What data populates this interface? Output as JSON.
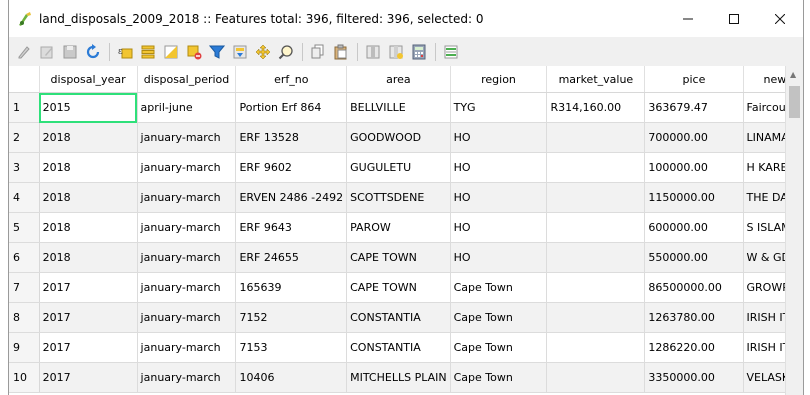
{
  "window": {
    "title": "land_disposals_2009_2018 :: Features total: 396, filtered: 396, selected: 0"
  },
  "toolbar": {
    "buttons": [
      {
        "name": "toggle-editing-button",
        "icon": "pencil-icon"
      },
      {
        "name": "toggle-multi-edit-button",
        "icon": "multi-edit-icon"
      },
      {
        "name": "save-edits-button",
        "icon": "save-icon"
      },
      {
        "name": "reload-table-button",
        "icon": "reload-icon"
      },
      {
        "name": "select-by-expression-button",
        "icon": "expression-select-icon"
      },
      {
        "name": "select-all-button",
        "icon": "select-all-icon"
      },
      {
        "name": "invert-selection-button",
        "icon": "invert-selection-icon"
      },
      {
        "name": "deselect-all-button",
        "icon": "deselect-icon"
      },
      {
        "name": "filter-select-button",
        "icon": "funnel-icon"
      },
      {
        "name": "move-selection-top-button",
        "icon": "move-top-icon"
      },
      {
        "name": "pan-to-selected-button",
        "icon": "pan-icon"
      },
      {
        "name": "zoom-to-selected-button",
        "icon": "zoom-icon"
      },
      {
        "name": "copy-rows-button",
        "icon": "copy-icon"
      },
      {
        "name": "paste-features-button",
        "icon": "paste-icon"
      },
      {
        "name": "delete-field-button",
        "icon": "delete-field-icon"
      },
      {
        "name": "new-field-button",
        "icon": "new-field-icon"
      },
      {
        "name": "field-calculator-button",
        "icon": "calculator-icon"
      },
      {
        "name": "conditional-formatting-button",
        "icon": "conditional-format-icon"
      }
    ]
  },
  "table": {
    "columns": [
      "disposal_year",
      "disposal_period",
      "erf_no",
      "area",
      "region",
      "market_value",
      "pice",
      "new"
    ],
    "rows": [
      {
        "num": "1",
        "cells": [
          "2015",
          "april-june",
          "Portion Erf 864",
          "BELLVILLE",
          "TYG",
          "R314,160.00",
          "363679.47",
          "Faircour"
        ]
      },
      {
        "num": "2",
        "cells": [
          "2018",
          "january-march",
          "ERF 13528",
          "GOODWOOD",
          "HO",
          "",
          "700000.00",
          "LINAMA"
        ]
      },
      {
        "num": "3",
        "cells": [
          "2018",
          "january-march",
          "ERF 9602",
          "GUGULETU",
          "HO",
          "",
          "100000.00",
          "H KAREL"
        ]
      },
      {
        "num": "4",
        "cells": [
          "2018",
          "january-march",
          "ERVEN  2486 -2492",
          "SCOTTSDENE",
          "HO",
          "",
          "1150000.00",
          "THE DAI"
        ]
      },
      {
        "num": "5",
        "cells": [
          "2018",
          "january-march",
          "ERF 9643",
          "PAROW",
          "HO",
          "",
          "600000.00",
          "S ISLAM"
        ]
      },
      {
        "num": "6",
        "cells": [
          "2018",
          "january-march",
          "ERF 24655",
          "CAPE TOWN",
          "HO",
          "",
          "550000.00",
          "W & GD"
        ]
      },
      {
        "num": "7",
        "cells": [
          "2017",
          "january-march",
          "165639",
          "CAPE TOWN",
          "Cape Town",
          "",
          "86500000.00",
          "GROWP"
        ]
      },
      {
        "num": "8",
        "cells": [
          "2017",
          "january-march",
          "7152",
          "CONSTANTIA",
          "Cape Town",
          "",
          "1263780.00",
          "IRISH IT"
        ]
      },
      {
        "num": "9",
        "cells": [
          "2017",
          "january-march",
          "7153",
          "CONSTANTIA",
          "Cape Town",
          "",
          "1286220.00",
          "IRISH IT"
        ]
      },
      {
        "num": "10",
        "cells": [
          "2017",
          "january-march",
          "10406",
          "MITCHELLS PLAIN",
          "Cape Town",
          "",
          "3350000.00",
          "VELASK"
        ]
      }
    ]
  },
  "colors": {
    "selection_outline": "#2ee07a",
    "alt_row": "#f2f2f2"
  }
}
